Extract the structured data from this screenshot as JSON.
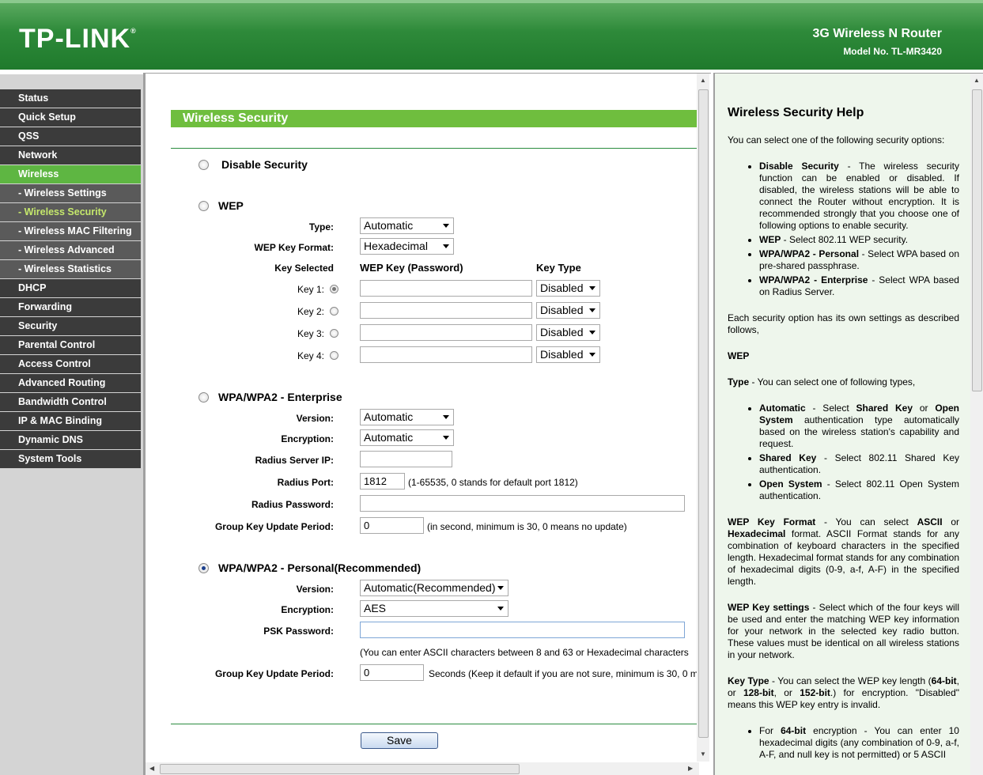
{
  "header": {
    "logo": "TP-LINK",
    "logo_mark": "®",
    "product": "3G Wireless N Router",
    "model": "Model No. TL-MR3420"
  },
  "nav": [
    {
      "label": "Status"
    },
    {
      "label": "Quick Setup"
    },
    {
      "label": "QSS"
    },
    {
      "label": "Network"
    },
    {
      "label": "Wireless"
    },
    {
      "label": "- Wireless Settings"
    },
    {
      "label": "- Wireless Security"
    },
    {
      "label": "- Wireless MAC Filtering"
    },
    {
      "label": "- Wireless Advanced"
    },
    {
      "label": "- Wireless Statistics"
    },
    {
      "label": "DHCP"
    },
    {
      "label": "Forwarding"
    },
    {
      "label": "Security"
    },
    {
      "label": "Parental Control"
    },
    {
      "label": "Access Control"
    },
    {
      "label": "Advanced Routing"
    },
    {
      "label": "Bandwidth Control"
    },
    {
      "label": "IP & MAC Binding"
    },
    {
      "label": "Dynamic DNS"
    },
    {
      "label": "System Tools"
    }
  ],
  "main": {
    "title": "Wireless Security",
    "disable": {
      "label": "Disable Security"
    },
    "wep": {
      "label": "WEP",
      "type_label": "Type:",
      "type_value": "Automatic",
      "format_label": "WEP Key Format:",
      "format_value": "Hexadecimal",
      "col_key_selected": "Key Selected",
      "col_key": "WEP Key (Password)",
      "col_type": "Key Type",
      "keys": [
        {
          "label": "Key 1:",
          "value": "",
          "type": "Disabled"
        },
        {
          "label": "Key 2:",
          "value": "",
          "type": "Disabled"
        },
        {
          "label": "Key 3:",
          "value": "",
          "type": "Disabled"
        },
        {
          "label": "Key 4:",
          "value": "",
          "type": "Disabled"
        }
      ]
    },
    "enterprise": {
      "label": "WPA/WPA2 - Enterprise",
      "version_label": "Version:",
      "version_value": "Automatic",
      "enc_label": "Encryption:",
      "enc_value": "Automatic",
      "ip_label": "Radius Server IP:",
      "ip_value": "",
      "port_label": "Radius Port:",
      "port_value": "1812",
      "port_hint": "(1-65535, 0 stands for default port 1812)",
      "pwd_label": "Radius Password:",
      "pwd_value": "",
      "gkup_label": "Group Key Update Period:",
      "gkup_value": "0",
      "gkup_hint": "(in second, minimum is 30, 0 means no update)"
    },
    "personal": {
      "label": "WPA/WPA2 - Personal(Recommended)",
      "version_label": "Version:",
      "version_value": "Automatic(Recommended)",
      "enc_label": "Encryption:",
      "enc_value": "AES",
      "psk_label": "PSK Password:",
      "psk_value": "",
      "psk_hint": "(You can enter ASCII characters between 8 and 63 or Hexadecimal characters",
      "gkup_label": "Group Key Update Period:",
      "gkup_value": "0",
      "gkup_hint": "Seconds (Keep it default if you are not sure, minimum is 30, 0 m"
    },
    "save_label": "Save"
  },
  "help": {
    "title": "Wireless Security Help",
    "intro": "You can select one of the following security options:",
    "opt1_b": "Disable Security",
    "opt1": " - The wireless security function can be enabled or disabled. If disabled, the wireless stations will be able to connect the Router without encryption. It is recommended strongly that you choose one of following options to enable security.",
    "opt2_b": "WEP",
    "opt2": " - Select 802.11 WEP security.",
    "opt3_b": "WPA/WPA2 - Personal",
    "opt3": " - Select WPA based on pre-shared passphrase.",
    "opt4_b": "WPA/WPA2 - Enterprise",
    "opt4": " - Select WPA based on Radius Server.",
    "each": "Each security option has its own settings as described follows,",
    "wep_head": "WEP",
    "type_b": "Type",
    "type": " - You can select one of following types,",
    "t1_b": "Automatic",
    "t1_a": " - Select ",
    "t1_b2": "Shared Key",
    "t1_c": " or ",
    "t1_b3": "Open System",
    "t1_d": " authentication type automatically based on the wireless station's capability and request.",
    "t2_b": "Shared Key",
    "t2": " - Select 802.11 Shared Key authentication.",
    "t3_b": "Open System",
    "t3": " - Select 802.11 Open System authentication.",
    "fmt_b": "WEP Key Format",
    "fmt_a": " - You can select ",
    "fmt_b2": "ASCII",
    "fmt_c": " or ",
    "fmt_b3": "Hexadecimal",
    "fmt_d": " format. ASCII Format stands for any combination of keyboard characters in the specified length. Hexadecimal format stands for any combination of hexadecimal digits (0-9, a-f, A-F) in the specified length.",
    "ks_b": "WEP Key settings",
    "ks": " - Select which of the four keys will be used and enter the matching WEP key information for your network in the selected key radio button. These values must be identical on all wireless stations in your network.",
    "kt_b": "Key Type",
    "kt_a": " - You can select the WEP key length (",
    "kt_b2": "64-bit",
    "kt_c": ", or ",
    "kt_b3": "128-bit",
    "kt_d": ", or ",
    "kt_b4": "152-bit",
    "kt_e": ".) for encryption. \"Disabled\" means this WEP key entry is invalid.",
    "f1_a": "For ",
    "f1_b": "64-bit",
    "f1_c": " encryption - You can enter 10 hexadecimal digits (any combination of 0-9, a-f, A-F, and null key is not permitted) or 5 ASCII"
  }
}
